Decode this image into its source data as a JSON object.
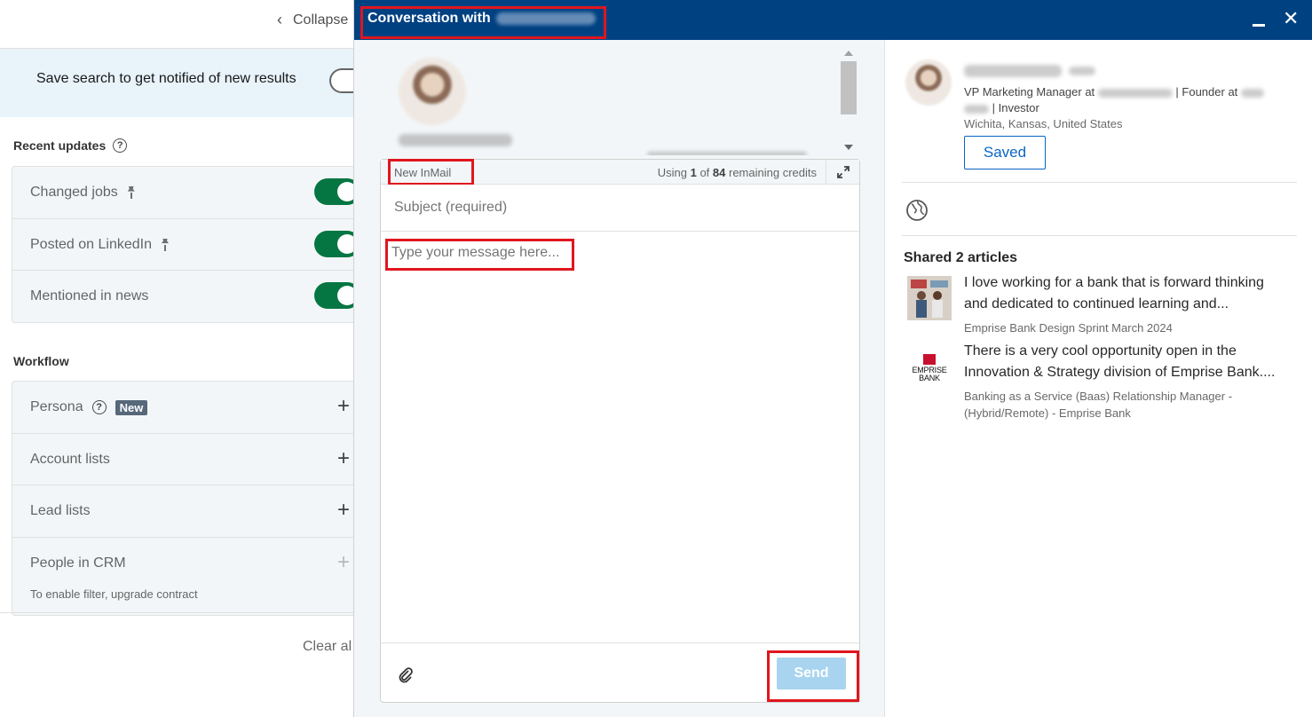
{
  "left_panel": {
    "collapse_label": "Collapse",
    "save_search_text": "Save search to get notified of new results",
    "recent_updates": {
      "title": "Recent updates",
      "items": [
        {
          "label": "Changed jobs",
          "enabled": true
        },
        {
          "label": "Posted on LinkedIn",
          "enabled": true
        },
        {
          "label": "Mentioned in news",
          "enabled": true
        }
      ]
    },
    "workflow": {
      "title": "Workflow",
      "items": [
        {
          "label": "Persona",
          "badge": "New"
        },
        {
          "label": "Account lists"
        },
        {
          "label": "Lead lists"
        },
        {
          "label": "People in CRM",
          "sublabel": "To enable filter, upgrade contract"
        }
      ]
    },
    "clear_all_label": "Clear al"
  },
  "conversation": {
    "title_prefix": "Conversation with",
    "compose": {
      "kind_label": "New InMail",
      "credits": {
        "prefix": "Using",
        "used": "1",
        "middle": "of",
        "remaining": "84",
        "suffix": "remaining credits"
      },
      "subject_placeholder": "Subject (required)",
      "message_placeholder": "Type your message here...",
      "send_label": "Send"
    }
  },
  "profile": {
    "headline_prefix": "VP Marketing Manager at",
    "headline_mid": "| Founder at",
    "headline_suffix": "| Investor",
    "location": "Wichita, Kansas, United States",
    "saved_label": "Saved",
    "shared_title": "Shared 2 articles",
    "articles": [
      {
        "title_line1": "I love working for a bank that is forward thinking",
        "title_line2": "and dedicated to continued learning and...",
        "source": "Emprise Bank Design Sprint March 2024"
      },
      {
        "title_line1": "There is a very cool opportunity open in the",
        "title_line2": "Innovation & Strategy division of Emprise Bank....",
        "source_line1": "Banking as a Service (Baas) Relationship Manager -",
        "source_line2": "(Hybrid/Remote) - Emprise Bank",
        "logo_text_1": "EMPRISE",
        "logo_text_2": "BANK"
      }
    ]
  },
  "colors": {
    "header_bg": "#004182",
    "highlight": "#e0161e",
    "toggle_on": "#057642",
    "link_blue": "#0a66c2",
    "send_disabled": "#a8d4ef"
  }
}
